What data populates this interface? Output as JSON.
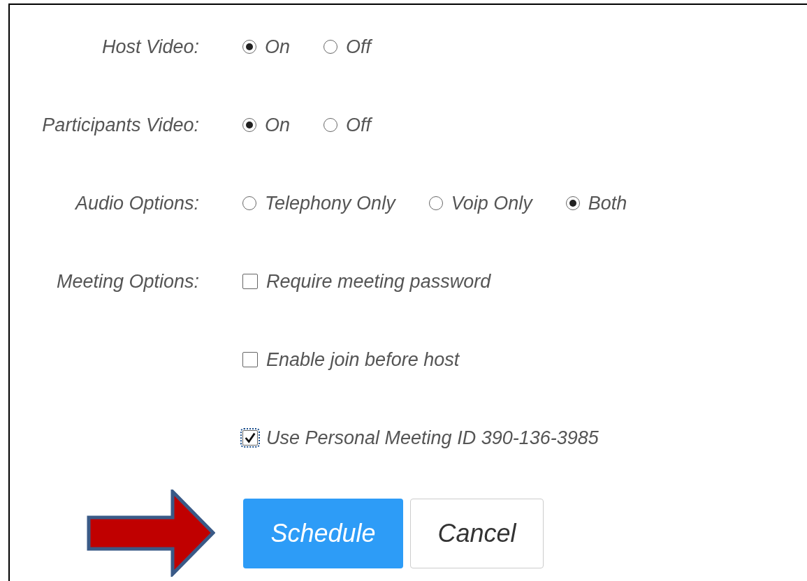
{
  "rows": [
    {
      "label": "Host Video:",
      "kind": "radio",
      "options": [
        {
          "label": "On",
          "selected": true
        },
        {
          "label": "Off",
          "selected": false
        }
      ]
    },
    {
      "label": "Participants Video:",
      "kind": "radio",
      "options": [
        {
          "label": "On",
          "selected": true
        },
        {
          "label": "Off",
          "selected": false
        }
      ]
    },
    {
      "label": "Audio Options:",
      "kind": "radio",
      "options": [
        {
          "label": "Telephony Only",
          "selected": false
        },
        {
          "label": "Voip Only",
          "selected": false
        },
        {
          "label": "Both",
          "selected": true
        }
      ]
    },
    {
      "label": "Meeting Options:",
      "kind": "checkbox",
      "options": [
        {
          "label": "Require meeting password",
          "checked": false
        },
        {
          "label": "Enable join before host",
          "checked": false
        },
        {
          "label": "Use Personal Meeting ID 390-136-3985",
          "checked": true
        }
      ]
    }
  ],
  "buttons": [
    {
      "label": "Schedule",
      "kind": "primary"
    },
    {
      "label": "Cancel",
      "kind": "secondary"
    }
  ]
}
